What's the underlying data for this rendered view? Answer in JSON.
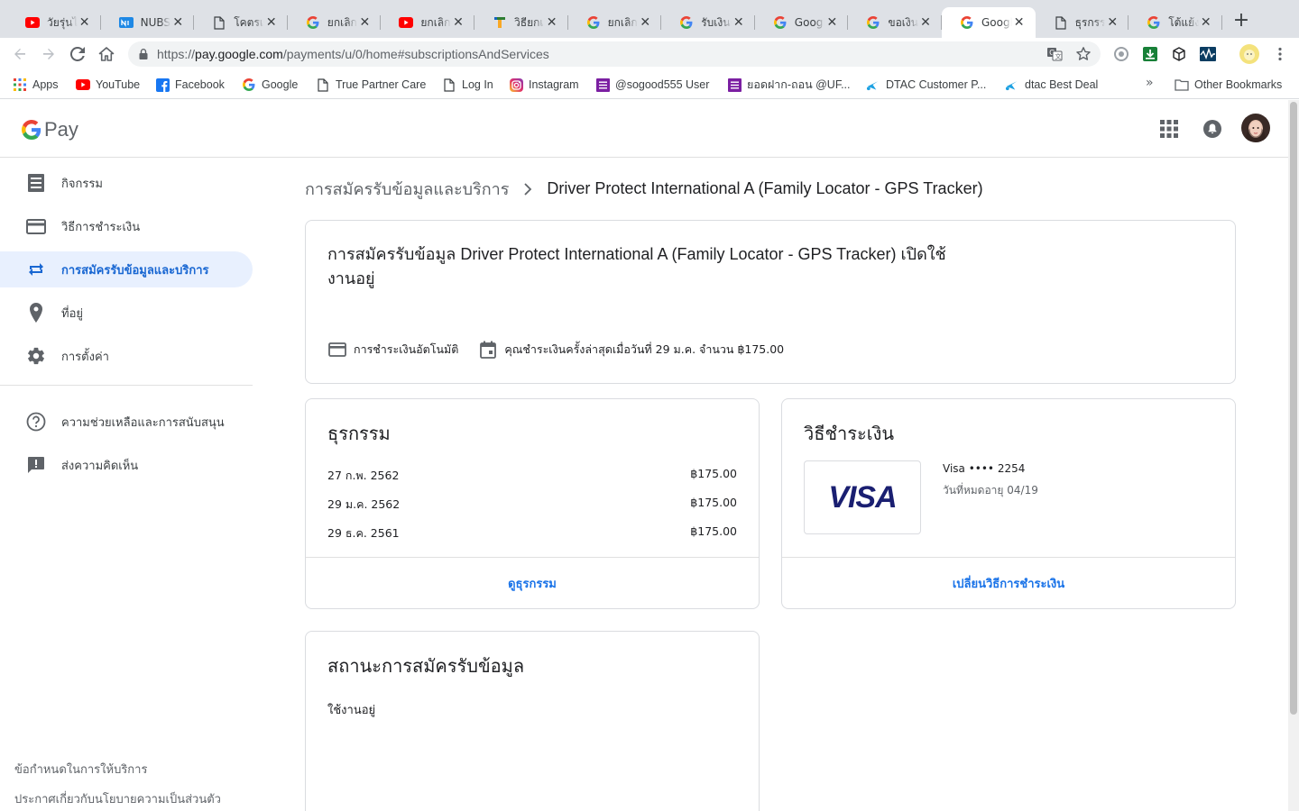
{
  "browser": {
    "tabs": [
      {
        "title": "วัยรุ่นไทย",
        "favicon": "youtube-icon"
      },
      {
        "title": "NUBSHOP",
        "favicon": "nubshop-icon"
      },
      {
        "title": "โคตรเซียน",
        "favicon": "document-icon"
      },
      {
        "title": "ยกเลิก s",
        "favicon": "google-icon"
      },
      {
        "title": "ยกเลิกแ",
        "favicon": "youtube-icon"
      },
      {
        "title": "วิธียกเลิก",
        "favicon": "generic-app-icon"
      },
      {
        "title": "ยกเลิก v",
        "favicon": "google-icon"
      },
      {
        "title": "รับเงินคืน",
        "favicon": "google-icon"
      },
      {
        "title": "Google",
        "favicon": "google-icon"
      },
      {
        "title": "ขอเงินคืน",
        "favicon": "google-icon"
      },
      {
        "title": "Google",
        "favicon": "google-icon",
        "active": true
      },
      {
        "title": "ธุรกรรม",
        "favicon": "document-icon"
      },
      {
        "title": "โต้แย้ง",
        "favicon": "google-icon"
      }
    ],
    "new_tab_label": "+",
    "url_prefix": "https://",
    "url_host": "pay.google.com",
    "url_path": "/payments/u/0/home#subscriptionsAndServices",
    "bookmarks": [
      {
        "label": "Apps",
        "icon": "apps-grid-icon"
      },
      {
        "label": "YouTube",
        "icon": "youtube-icon"
      },
      {
        "label": "Facebook",
        "icon": "facebook-icon"
      },
      {
        "label": "Google",
        "icon": "google-icon"
      },
      {
        "label": "True Partner Care",
        "icon": "document-icon"
      },
      {
        "label": "Log In",
        "icon": "document-icon"
      },
      {
        "label": "Instagram",
        "icon": "instagram-icon"
      },
      {
        "label": "@sogood555 User",
        "icon": "list-icon"
      },
      {
        "label": "ยอดฝาก-ถอน @UF...",
        "icon": "list-icon"
      },
      {
        "label": "DTAC Customer P...",
        "icon": "dtac-icon"
      },
      {
        "label": "dtac Best Deal",
        "icon": "dtac-icon"
      }
    ],
    "bookmarks_overflow": "»",
    "other_bookmarks": "Other Bookmarks"
  },
  "gpay": {
    "logo_text": "Pay",
    "nav": [
      {
        "label": "กิจกรรม",
        "icon": "activity-list-icon"
      },
      {
        "label": "วิธีการชำระเงิน",
        "icon": "credit-card-icon"
      },
      {
        "label": "การสมัครรับข้อมูลและบริการ",
        "icon": "repeat-icon",
        "active": true
      },
      {
        "label": "ที่อยู่",
        "icon": "location-pin-icon"
      },
      {
        "label": "การตั้งค่า",
        "icon": "gear-icon"
      }
    ],
    "nav_secondary": [
      {
        "label": "ความช่วยเหลือและการสนับสนุน",
        "icon": "help-icon"
      },
      {
        "label": "ส่งความคิดเห็น",
        "icon": "feedback-icon"
      }
    ],
    "footer": {
      "terms": "ข้อกำหนดในการให้บริการ",
      "privacy": "ประกาศเกี่ยวกับนโยบายความเป็นส่วนตัว"
    }
  },
  "breadcrumb": {
    "parent": "การสมัครรับข้อมูลและบริการ",
    "current": "Driver Protect International A (Family Locator - GPS Tracker)"
  },
  "subscription": {
    "title": "การสมัครรับข้อมูล Driver Protect International A (Family Locator - GPS Tracker) เปิดใช้งานอยู่",
    "auto_pay": "การชำระเงินอัตโนมัติ",
    "last_payment": "คุณชำระเงินครั้งล่าสุดเมื่อวันที่ 29 ม.ค. จำนวน ฿175.00"
  },
  "transactions": {
    "heading": "ธุรกรรม",
    "rows": [
      {
        "date": "27 ก.พ. 2562",
        "amount": "฿175.00"
      },
      {
        "date": "29 ม.ค. 2562",
        "amount": "฿175.00"
      },
      {
        "date": "29 ธ.ค. 2561",
        "amount": "฿175.00"
      }
    ],
    "link": "ดูธุรกรรม"
  },
  "payment_method": {
    "heading": "วิธีชำระเงิน",
    "brand": "VISA",
    "card_name": "Visa •••• 2254",
    "expiry": "วันที่หมดอายุ 04/19",
    "link": "เปลี่ยนวิธีการชำระเงิน"
  },
  "subscription_status": {
    "heading": "สถานะการสมัครรับข้อมูล",
    "value": "ใช้งานอยู่"
  },
  "colors": {
    "accent": "#1a73e8",
    "active_nav_bg": "#e8f0fe",
    "visa_blue": "#1a1f71"
  }
}
